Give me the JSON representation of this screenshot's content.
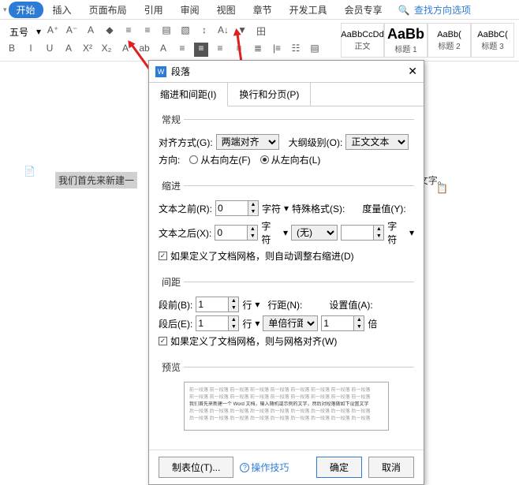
{
  "menu": {
    "dropdown_tri": "▾",
    "tabs": [
      "开始",
      "插入",
      "页面布局",
      "引用",
      "审阅",
      "视图",
      "章节",
      "开发工具",
      "会员专享"
    ],
    "search_label": "查找方向选项",
    "search_icon": "🔍"
  },
  "ribbon": {
    "font_size": "五号",
    "row1_icons": [
      "A⁺",
      "A⁻",
      "A",
      "◆",
      "≡",
      "≡",
      "▤",
      "▧",
      "↕",
      "A↓",
      "▼",
      "田"
    ],
    "row2_icons": [
      "B",
      "I",
      "U",
      "A",
      "X²",
      "X₂",
      "A",
      "ab",
      "A",
      "≡",
      "≡",
      "≡",
      "≡",
      "≣",
      "|≡",
      "☷",
      "▤"
    ],
    "styles": [
      {
        "sample": "AaBbCcDd",
        "label": "正文"
      },
      {
        "sample": "AaBb",
        "label": "标题 1"
      },
      {
        "sample": "AaBb(",
        "label": "标题 2"
      },
      {
        "sample": "AaBbC(",
        "label": "标题 3"
      }
    ]
  },
  "doc": {
    "line_prefix": "我们首先来新建一",
    "line_suffix": "文字。",
    "clipboard_icon": "📋",
    "sidebar_icon": "📄"
  },
  "dialog": {
    "title": "段落",
    "tabs": [
      "缩进和间距(I)",
      "换行和分页(P)"
    ],
    "groups": {
      "general": {
        "legend": "常规",
        "align_label": "对齐方式(G):",
        "align_value": "两端对齐",
        "outline_label": "大纲级别(O):",
        "outline_value": "正文文本",
        "direction_label": "方向:",
        "dir_rtl": "从右向左(F)",
        "dir_ltr": "从左向右(L)"
      },
      "indent": {
        "legend": "缩进",
        "before_label": "文本之前(R):",
        "before_value": "0",
        "after_label": "文本之后(X):",
        "after_value": "0",
        "unit_chars": "字符",
        "special_label": "特殊格式(S):",
        "special_value": "(无)",
        "metric_label": "度量值(Y):",
        "metric_value": "",
        "checkbox": "如果定义了文档网格，则自动调整右缩进(D)"
      },
      "spacing": {
        "legend": "间距",
        "before_label": "段前(B):",
        "before_value": "1",
        "after_label": "段后(E):",
        "after_value": "1",
        "unit_lines": "行",
        "line_spacing_label": "行距(N):",
        "line_spacing_value": "单倍行距",
        "set_label": "设置值(A):",
        "set_value": "1",
        "unit_bei": "倍",
        "checkbox": "如果定义了文档网格，则与网格对齐(W)"
      },
      "preview": {
        "legend": "预览",
        "lines": [
          "前一段落 前一段落 前一段落 前一段落 前一段落 前一段落 前一段落 前一段落 前一段落",
          "前一段落 前一段落 前一段落 前一段落 前一段落 前一段落 前一段落 前一段落 前一段落",
          "我们首先来新建一个 Word 文档，输入随机或示例的文字，然后对段落做如下设置文字",
          "后一段落 后一段落 后一段落 后一段落 后一段落 后一段落 后一段落 后一段落 后一段落",
          "后一段落 后一段落 后一段落 后一段落 后一段落 后一段落 后一段落 后一段落 后一段落"
        ]
      }
    },
    "footer": {
      "tabs_btn": "制表位(T)...",
      "tips": "操作技巧",
      "ok": "确定",
      "cancel": "取消"
    }
  }
}
